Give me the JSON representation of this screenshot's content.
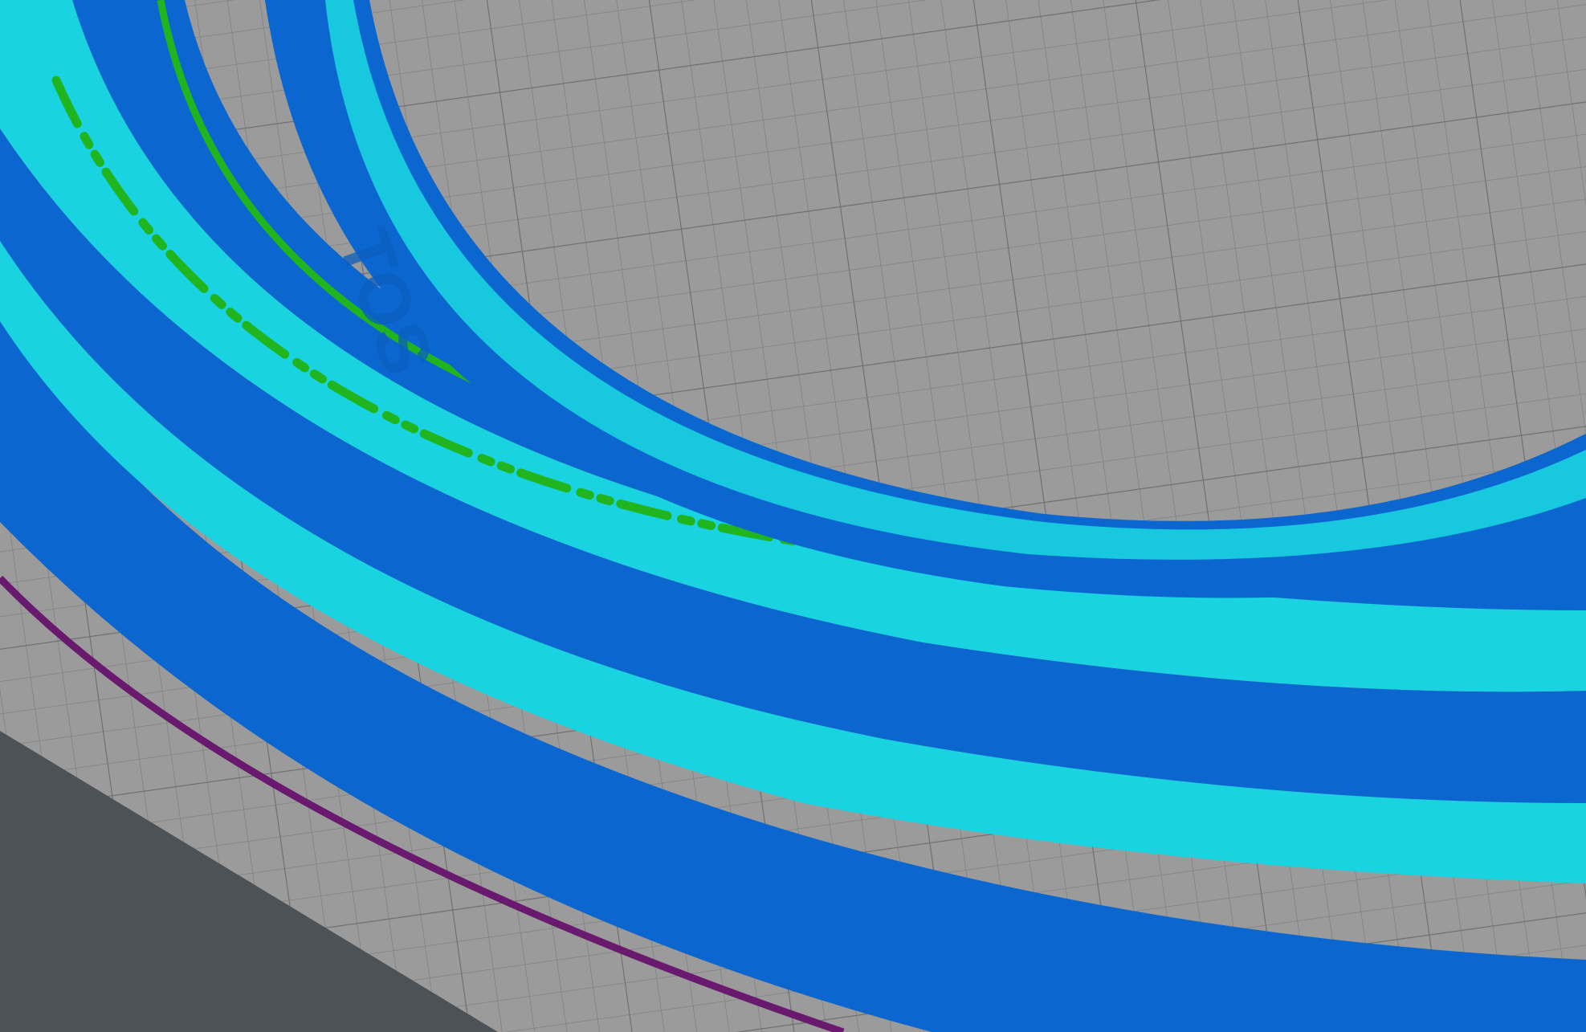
{
  "app": {
    "view": "slicer-3d-preview"
  },
  "scene": {
    "background_color": "#4d5257",
    "bed_color": "#9b9b9b",
    "grid_color": "#7c7c7c",
    "skirt_color": "#6a1a6e",
    "wall_color": "#0b67cf",
    "wall_shadow_color": "#0853a8",
    "top_surface_color": "#19d3e0",
    "top_line_color": "#0e96b8",
    "infill_color": "#20b51e",
    "embossed_text": "TOS"
  }
}
